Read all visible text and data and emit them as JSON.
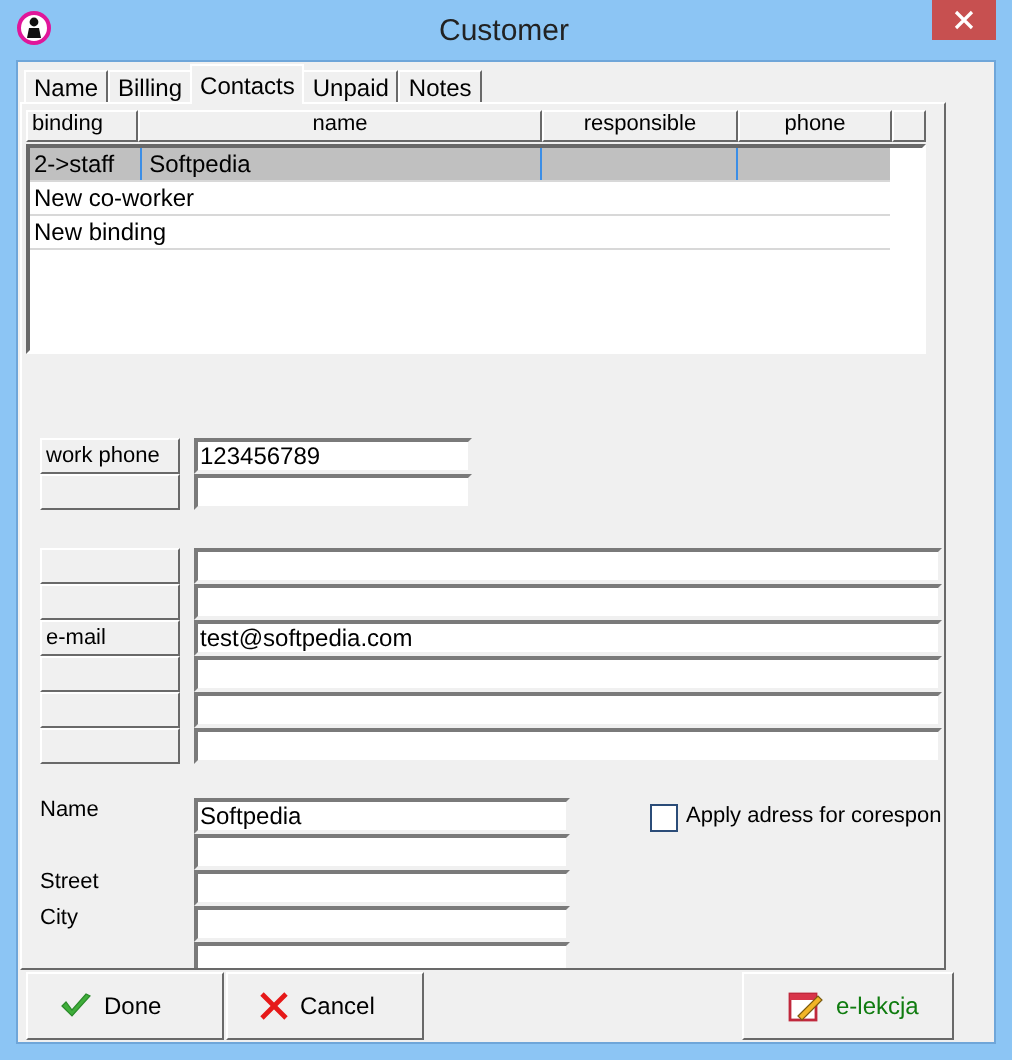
{
  "window": {
    "title": "Customer"
  },
  "tabs": [
    {
      "label": "Name",
      "selected": false
    },
    {
      "label": "Billing",
      "selected": false
    },
    {
      "label": "Contacts",
      "selected": true
    },
    {
      "label": "Unpaid",
      "selected": false
    },
    {
      "label": "Notes",
      "selected": false
    }
  ],
  "table": {
    "columns": [
      "binding",
      "name",
      "responsible",
      "phone"
    ],
    "rows": [
      {
        "cells": [
          "2->staff",
          "Softpedia"
        ],
        "selected": true
      },
      {
        "cells": [
          "New co-worker"
        ],
        "selected": false
      },
      {
        "cells": [
          "New binding"
        ],
        "selected": false
      }
    ]
  },
  "phones": [
    {
      "kind": "field",
      "label": "work phone",
      "value": "123456789"
    },
    {
      "kind": "blank"
    }
  ],
  "contacts": [
    {
      "kind": "blank"
    },
    {
      "kind": "blank"
    },
    {
      "kind": "field",
      "label": "e-mail",
      "value": "test@softpedia.com"
    },
    {
      "kind": "blank"
    },
    {
      "kind": "blank"
    },
    {
      "kind": "blank"
    }
  ],
  "address": {
    "fields": [
      {
        "kind": "field",
        "label": "Name",
        "value": "Softpedia"
      },
      {
        "kind": "blank"
      },
      {
        "kind": "field",
        "label": "Street"
      },
      {
        "kind": "field",
        "label": "City"
      },
      {
        "kind": "blank"
      }
    ],
    "checkbox": {
      "label": "Apply adress for corespon",
      "checked": false
    }
  },
  "buttons": [
    {
      "label": "Done",
      "kind": "done"
    },
    {
      "label": "Cancel",
      "kind": "cancel"
    },
    {
      "label": "e-lekcja",
      "kind": "elekcja"
    }
  ]
}
